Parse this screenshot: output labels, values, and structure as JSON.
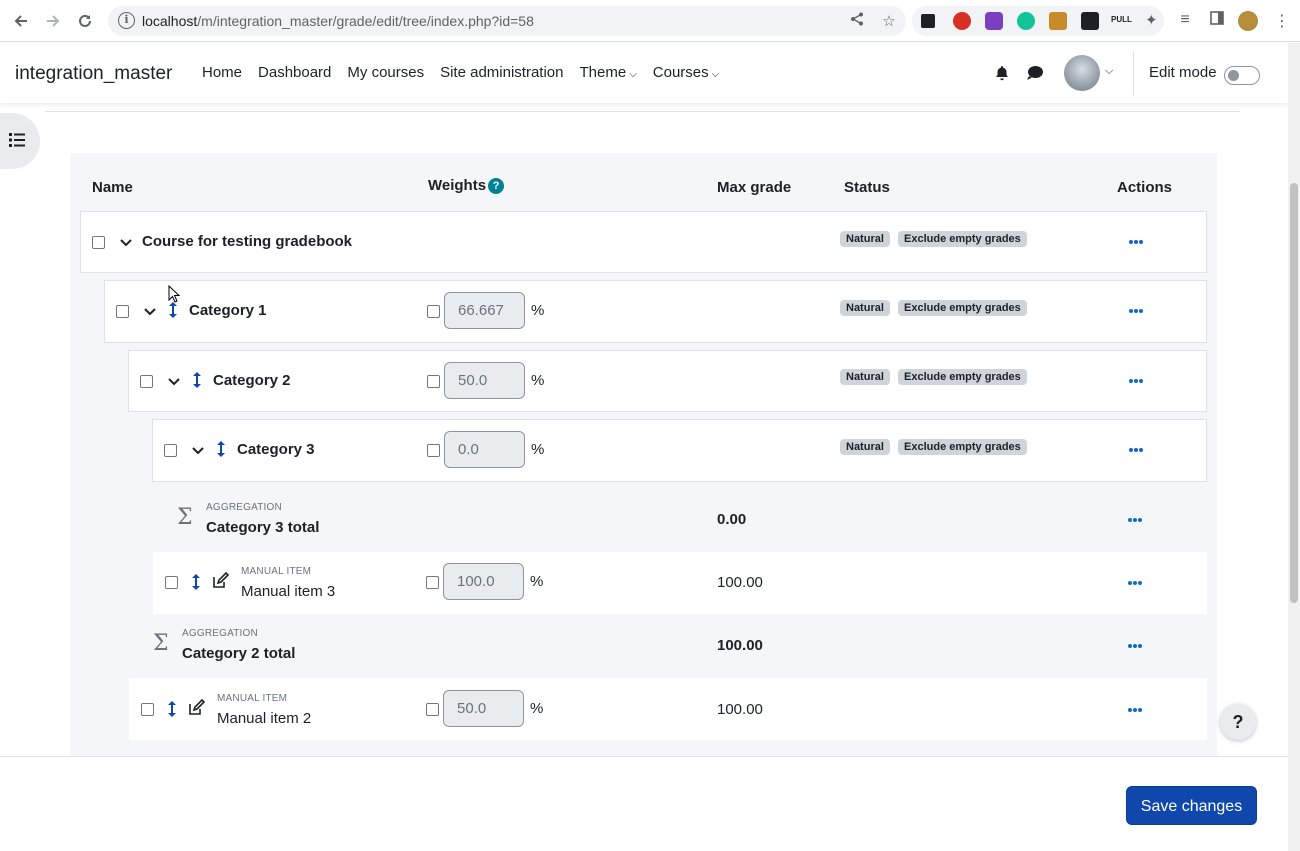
{
  "browser": {
    "url_host": "localhost",
    "url_path": "/m/integration_master/grade/edit/tree/index.php?id=58"
  },
  "navbar": {
    "brand": "integration_master",
    "links": [
      "Home",
      "Dashboard",
      "My courses",
      "Site administration",
      "Theme",
      "Courses"
    ],
    "edit_mode_label": "Edit mode"
  },
  "table": {
    "headers": {
      "name": "Name",
      "weights": "Weights",
      "max_grade": "Max grade",
      "status": "Status",
      "actions": "Actions"
    },
    "help_glyph": "?",
    "percent_sign": "%",
    "rows": {
      "course": {
        "name": "Course for testing gradebook",
        "badges": [
          "Natural",
          "Exclude empty grades"
        ]
      },
      "cat1": {
        "name": "Category 1",
        "weight": "66.667",
        "badges": [
          "Natural",
          "Exclude empty grades"
        ]
      },
      "cat2": {
        "name": "Category 2",
        "weight": "50.0",
        "badges": [
          "Natural",
          "Exclude empty grades"
        ]
      },
      "cat3": {
        "name": "Category 3",
        "weight": "0.0",
        "badges": [
          "Natural",
          "Exclude empty grades"
        ]
      },
      "cat3_total": {
        "type": "AGGREGATION",
        "name": "Category 3 total",
        "max_grade": "0.00"
      },
      "item3": {
        "type": "MANUAL ITEM",
        "name": "Manual item 3",
        "weight": "100.0",
        "max_grade": "100.00"
      },
      "cat2_total": {
        "type": "AGGREGATION",
        "name": "Category 2 total",
        "max_grade": "100.00"
      },
      "item2": {
        "type": "MANUAL ITEM",
        "name": "Manual item 2",
        "weight": "50.0",
        "max_grade": "100.00"
      }
    }
  },
  "footer": {
    "save_label": "Save changes"
  },
  "help_float": "?",
  "colors": {
    "brand_blue": "#0f47ad",
    "action_blue": "#0f6cbf",
    "badge_bg": "#ced4da",
    "help_teal": "#008196"
  }
}
